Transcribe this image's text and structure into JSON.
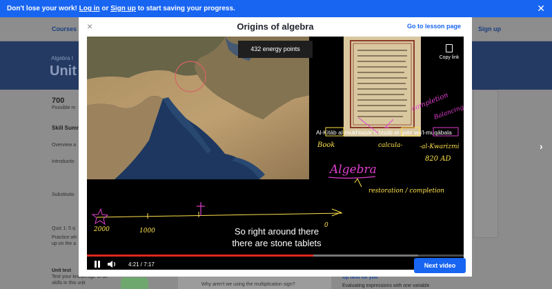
{
  "banner": {
    "prefix": "Don't lose your work!",
    "login": "Log in",
    "or": "or",
    "signup": "Sign up",
    "suffix": "to start saving your progress.",
    "close": "✕"
  },
  "background": {
    "nav_courses": "Courses",
    "nav_signup": "Sign up",
    "hero_subtitle": "Algebra I",
    "hero_title": "Unit",
    "points_value": "700",
    "points_label": "Possible m",
    "skill_summary": "Skill Summ",
    "overview": "Overview a",
    "introduction": "Introductio",
    "substitution": "Substitutio",
    "quiz": "Quiz 1: 5 q",
    "quiz_desc1": "Practice wh",
    "quiz_desc2": "up on the a",
    "unit_test": "Unit test",
    "unit_test_desc1": "Test your knowledge of all",
    "unit_test_desc2": "skills in this unit",
    "question": "Why aren't we using the multiplication sign?",
    "up_next": "Up next for you",
    "up_next_item": "Evaluating expressions with one variable"
  },
  "modal": {
    "close": "×",
    "title": "Origins of algebra",
    "go_to_lesson": "Go to lesson page",
    "next_video": "Next video"
  },
  "video": {
    "energy_points": "432 energy points",
    "copy_link": "Copy link",
    "subtitle_line1": "So right around there",
    "subtitle_line2": "there are stone tablets",
    "time": "4:21 / 7:17",
    "progress": 0.6,
    "cc": "CC"
  },
  "board": {
    "title_text": "Al-Kitāb al-mukhtaṣar fī ḥisāb al-gabr wa'l-muqābala",
    "book": "Book",
    "calculation": "calcula-",
    "completion": "completion",
    "balancing": "Balancing",
    "author": "-al-Kwarizmi",
    "year": "820 AD",
    "algebra": "Algebra",
    "restoration": "restoration / completion",
    "year_2000": "2000",
    "year_1000": "1000",
    "zero": "0"
  },
  "colors": {
    "khan_blue": "#1865f2",
    "progress_red": "#e0281f",
    "chalk_yellow": "#ffe34d",
    "chalk_pink": "#e040d0"
  }
}
